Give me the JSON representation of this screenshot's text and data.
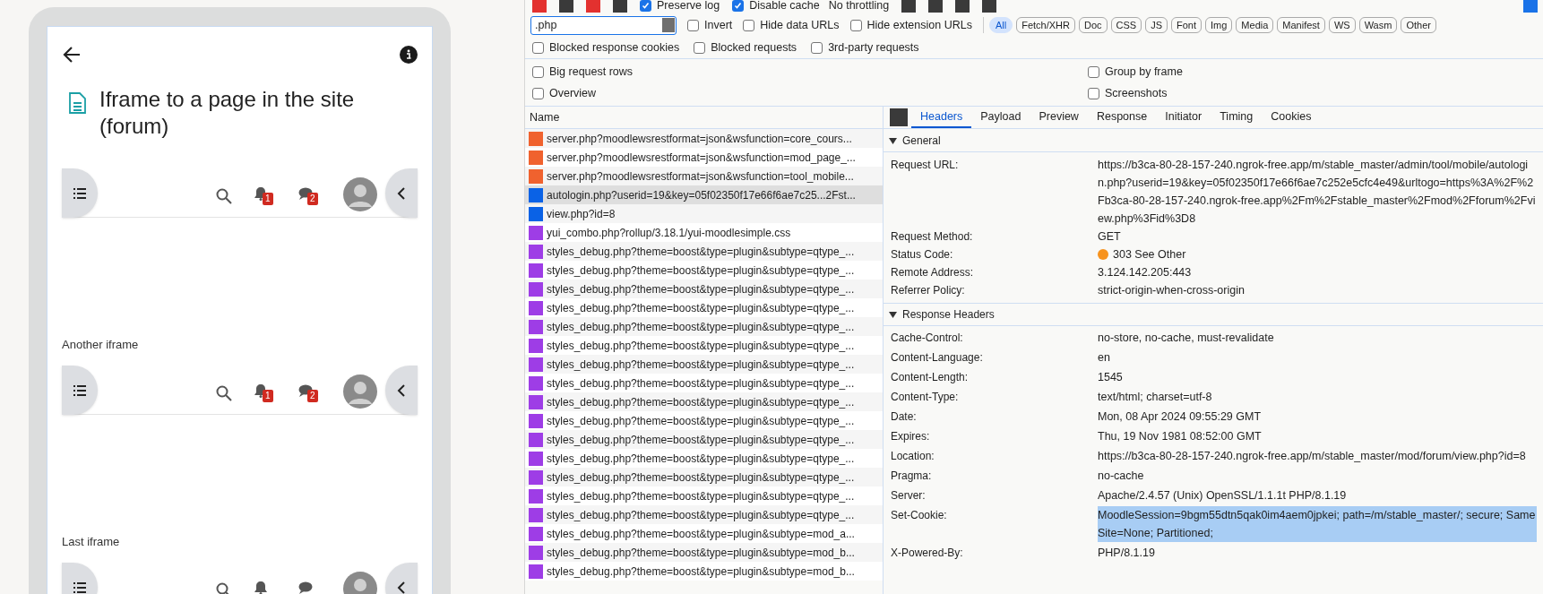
{
  "phone": {
    "title": "Iframe to a page in the site (forum)",
    "iframes": [
      {
        "badges": [
          "1",
          "2"
        ]
      },
      {
        "label": "Another iframe",
        "badges": [
          "1",
          "2"
        ]
      },
      {
        "label": "Last iframe"
      }
    ]
  },
  "devtools": {
    "toolbar": {
      "checkboxes": [
        {
          "label": "Preserve log",
          "checked": true
        },
        {
          "label": "Disable cache",
          "checked": true
        }
      ],
      "throttling": "No throttling"
    },
    "filter": {
      "value": ".php",
      "checkboxes": [
        {
          "label": "Invert",
          "checked": false
        },
        {
          "label": "Hide data URLs",
          "checked": false
        },
        {
          "label": "Hide extension URLs",
          "checked": false
        }
      ],
      "types": [
        {
          "label": "All",
          "selected": true
        },
        {
          "label": "Fetch/XHR",
          "selected": false
        },
        {
          "label": "Doc",
          "selected": false
        },
        {
          "label": "CSS",
          "selected": false
        },
        {
          "label": "JS",
          "selected": false
        },
        {
          "label": "Font",
          "selected": false
        },
        {
          "label": "Img",
          "selected": false
        },
        {
          "label": "Media",
          "selected": false
        },
        {
          "label": "Manifest",
          "selected": false
        },
        {
          "label": "WS",
          "selected": false
        },
        {
          "label": "Wasm",
          "selected": false
        },
        {
          "label": "Other",
          "selected": false
        }
      ],
      "more": [
        {
          "label": "Blocked response cookies",
          "checked": false
        },
        {
          "label": "Blocked requests",
          "checked": false
        },
        {
          "label": "3rd-party requests",
          "checked": false
        }
      ]
    },
    "settings": [
      {
        "label": "Big request rows",
        "checked": false
      },
      {
        "label": "Group by frame",
        "checked": false
      },
      {
        "label": "Overview",
        "checked": false
      },
      {
        "label": "Screenshots",
        "checked": false
      }
    ],
    "requests": {
      "column": "Name",
      "rows": [
        {
          "name": "server.php?moodlewsrestformat=json&wsfunction=core_cours...",
          "kind": "fetch",
          "selected": false
        },
        {
          "name": "server.php?moodlewsrestformat=json&wsfunction=mod_page_...",
          "kind": "fetch",
          "selected": false
        },
        {
          "name": "server.php?moodlewsrestformat=json&wsfunction=tool_mobile...",
          "kind": "fetch",
          "selected": false
        },
        {
          "name": "autologin.php?userid=19&key=05f02350f17e66f6ae7c25...2Fst...",
          "kind": "document",
          "selected": true
        },
        {
          "name": "view.php?id=8",
          "kind": "document",
          "selected": false
        },
        {
          "name": "yui_combo.php?rollup/3.18.1/yui-moodlesimple.css",
          "kind": "stylesheet",
          "selected": false
        },
        {
          "name": "styles_debug.php?theme=boost&type=plugin&subtype=qtype_...",
          "kind": "stylesheet",
          "selected": false
        },
        {
          "name": "styles_debug.php?theme=boost&type=plugin&subtype=qtype_...",
          "kind": "stylesheet",
          "selected": false
        },
        {
          "name": "styles_debug.php?theme=boost&type=plugin&subtype=qtype_...",
          "kind": "stylesheet",
          "selected": false
        },
        {
          "name": "styles_debug.php?theme=boost&type=plugin&subtype=qtype_...",
          "kind": "stylesheet",
          "selected": false
        },
        {
          "name": "styles_debug.php?theme=boost&type=plugin&subtype=qtype_...",
          "kind": "stylesheet",
          "selected": false
        },
        {
          "name": "styles_debug.php?theme=boost&type=plugin&subtype=qtype_...",
          "kind": "stylesheet",
          "selected": false
        },
        {
          "name": "styles_debug.php?theme=boost&type=plugin&subtype=qtype_...",
          "kind": "stylesheet",
          "selected": false
        },
        {
          "name": "styles_debug.php?theme=boost&type=plugin&subtype=qtype_...",
          "kind": "stylesheet",
          "selected": false
        },
        {
          "name": "styles_debug.php?theme=boost&type=plugin&subtype=qtype_...",
          "kind": "stylesheet",
          "selected": false
        },
        {
          "name": "styles_debug.php?theme=boost&type=plugin&subtype=qtype_...",
          "kind": "stylesheet",
          "selected": false
        },
        {
          "name": "styles_debug.php?theme=boost&type=plugin&subtype=qtype_...",
          "kind": "stylesheet",
          "selected": false
        },
        {
          "name": "styles_debug.php?theme=boost&type=plugin&subtype=qtype_...",
          "kind": "stylesheet",
          "selected": false
        },
        {
          "name": "styles_debug.php?theme=boost&type=plugin&subtype=qtype_...",
          "kind": "stylesheet",
          "selected": false
        },
        {
          "name": "styles_debug.php?theme=boost&type=plugin&subtype=qtype_...",
          "kind": "stylesheet",
          "selected": false
        },
        {
          "name": "styles_debug.php?theme=boost&type=plugin&subtype=qtype_...",
          "kind": "stylesheet",
          "selected": false
        },
        {
          "name": "styles_debug.php?theme=boost&type=plugin&subtype=mod_a...",
          "kind": "stylesheet",
          "selected": false
        },
        {
          "name": "styles_debug.php?theme=boost&type=plugin&subtype=mod_b...",
          "kind": "stylesheet",
          "selected": false
        },
        {
          "name": "styles_debug.php?theme=boost&type=plugin&subtype=mod_b...",
          "kind": "stylesheet",
          "selected": false
        }
      ]
    },
    "detail": {
      "tabs": [
        {
          "label": "Headers",
          "selected": true
        },
        {
          "label": "Payload",
          "selected": false
        },
        {
          "label": "Preview",
          "selected": false
        },
        {
          "label": "Response",
          "selected": false
        },
        {
          "label": "Initiator",
          "selected": false
        },
        {
          "label": "Timing",
          "selected": false
        },
        {
          "label": "Cookies",
          "selected": false
        }
      ],
      "sections": [
        {
          "title": "General",
          "rows": [
            {
              "name": "Request URL:",
              "value": "https://b3ca-80-28-157-240.ngrok-free.app/m/stable_master/admin/tool/mobile/autologin.php?userid=19&key=05f02350f17e66f6ae7c252e5cfc4e49&urltogo=https%3A%2F%2Fb3ca-80-28-157-240.ngrok-free.app%2Fm%2Fstable_master%2Fmod%2Fforum%2Fview.php%3Fid%3D8",
              "selected": false
            },
            {
              "name": "Request Method:",
              "value": "GET",
              "selected": false
            },
            {
              "name": "Status Code:",
              "value": "303 See Other",
              "color": "#f7931e",
              "selected": false
            },
            {
              "name": "Remote Address:",
              "value": "3.124.142.205:443",
              "selected": false
            },
            {
              "name": "Referrer Policy:",
              "value": "strict-origin-when-cross-origin",
              "selected": false
            }
          ]
        },
        {
          "title": "Response Headers",
          "rows": [
            {
              "name": "Cache-Control:",
              "value": "no-store, no-cache, must-revalidate",
              "selected": false
            },
            {
              "name": "Content-Language:",
              "value": "en",
              "selected": false
            },
            {
              "name": "Content-Length:",
              "value": "1545",
              "selected": false
            },
            {
              "name": "Content-Type:",
              "value": "text/html; charset=utf-8",
              "selected": false
            },
            {
              "name": "Date:",
              "value": "Mon, 08 Apr 2024 09:55:29 GMT",
              "selected": false
            },
            {
              "name": "Expires:",
              "value": "Thu, 19 Nov 1981 08:52:00 GMT",
              "selected": false
            },
            {
              "name": "Location:",
              "value": "https://b3ca-80-28-157-240.ngrok-free.app/m/stable_master/mod/forum/view.php?id=8",
              "selected": false
            },
            {
              "name": "Pragma:",
              "value": "no-cache",
              "selected": false
            },
            {
              "name": "Server:",
              "value": "Apache/2.4.57 (Unix) OpenSSL/1.1.1t PHP/8.1.19",
              "selected": false
            },
            {
              "name": "Set-Cookie:",
              "value": "MoodleSession=9bgm55dtn5qak0im4aem0jpkei; path=/m/stable_master/; secure; SameSite=None; Partitioned;",
              "selected": true
            },
            {
              "name": "X-Powered-By:",
              "value": "PHP/8.1.19",
              "selected": false
            }
          ]
        }
      ]
    }
  }
}
